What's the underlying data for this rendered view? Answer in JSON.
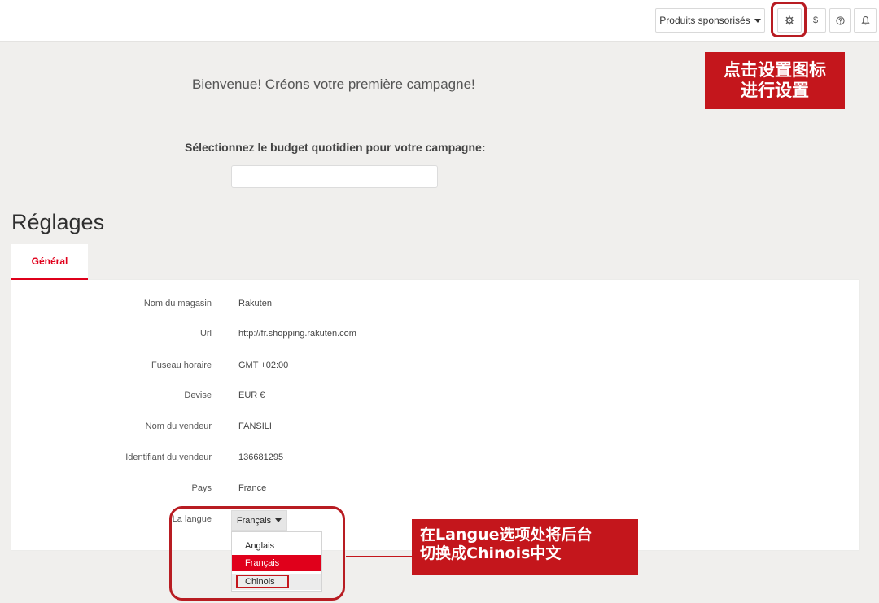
{
  "topbar": {
    "product_selector": "Produits sponsorisés",
    "icons": [
      "gear-icon",
      "dollar-icon",
      "help-icon",
      "bell-icon"
    ],
    "dollar_text": "$"
  },
  "annotations": {
    "gear_callout": "点击设置图标\n进行设置",
    "language_callout": "在Langue选项处将后台\n切换成Chinois中文",
    "accent_color": "#c4161c"
  },
  "welcome": {
    "heading": "Bienvenue! Créons votre première campagne!",
    "budget_label": "Sélectionnez le budget quotidien pour votre campagne:",
    "budget_value": ""
  },
  "settings": {
    "title": "Réglages",
    "tab": "Général",
    "rows": [
      {
        "label": "Nom du magasin",
        "value": "Rakuten"
      },
      {
        "label": "Url",
        "value": "http://fr.shopping.rakuten.com"
      },
      {
        "label": "Fuseau horaire",
        "value": "GMT +02:00"
      },
      {
        "label": "Devise",
        "value": "EUR €"
      },
      {
        "label": "Nom du vendeur",
        "value": "FANSILI"
      },
      {
        "label": "Identifiant du vendeur",
        "value": "136681295"
      },
      {
        "label": "Pays",
        "value": "France"
      }
    ],
    "language": {
      "label": "La langue",
      "selected": "Français",
      "options": [
        "Anglais",
        "Français",
        "Chinois"
      ]
    }
  }
}
